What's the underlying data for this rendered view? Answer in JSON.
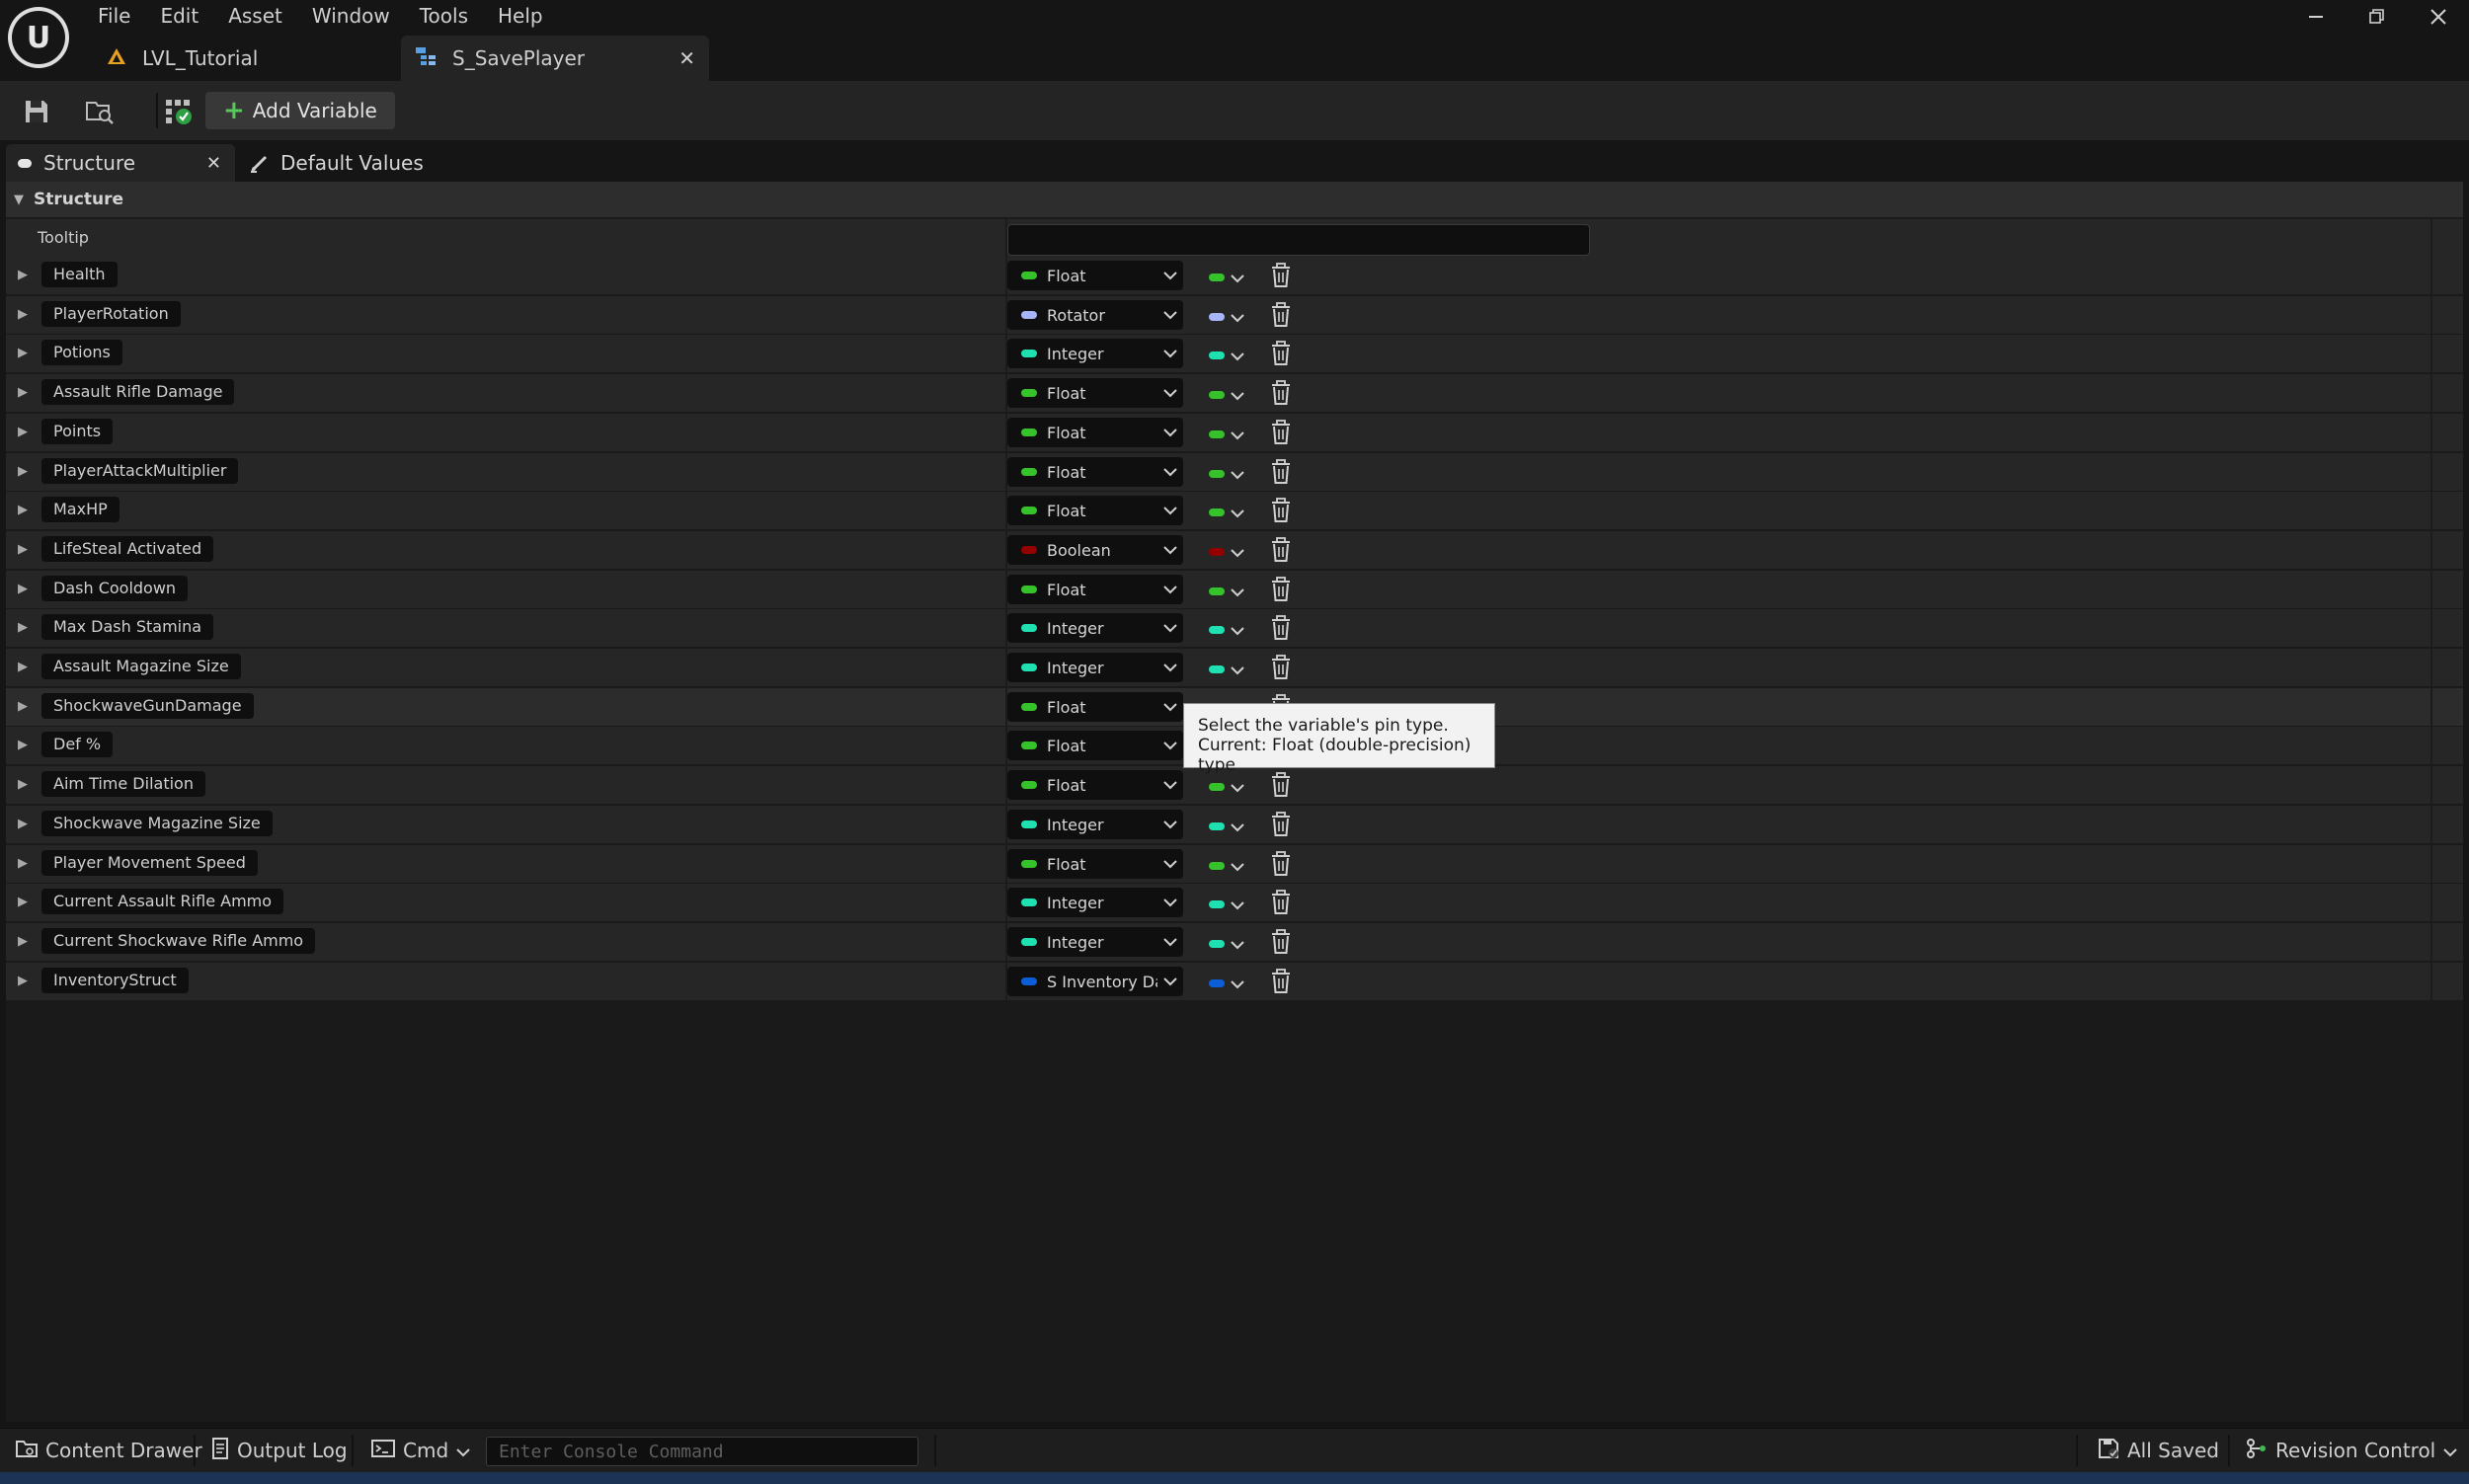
{
  "menu": {
    "items": [
      "File",
      "Edit",
      "Asset",
      "Window",
      "Tools",
      "Help"
    ]
  },
  "doc_tabs": [
    {
      "label": "LVL_Tutorial",
      "active": false
    },
    {
      "label": "S_SavePlayer",
      "active": true
    }
  ],
  "toolbar": {
    "add_variable_label": "Add Variable"
  },
  "panel_tabs": {
    "structure": "Structure",
    "default_values": "Default Values"
  },
  "section": {
    "title": "Structure",
    "tooltip_label": "Tooltip",
    "tooltip_value": ""
  },
  "pin_colors": {
    "Float": "#35c22a",
    "Rotator": "#a8b4f8",
    "Integer": "#1fe0b0",
    "Boolean": "#940000",
    "Struct": "#0b5ed6"
  },
  "variables": [
    {
      "name": "Health",
      "type": "Float",
      "pin": "Float"
    },
    {
      "name": "PlayerRotation",
      "type": "Rotator",
      "pin": "Rotator"
    },
    {
      "name": "Potions",
      "type": "Integer",
      "pin": "Integer"
    },
    {
      "name": "Assault Rifle Damage",
      "type": "Float",
      "pin": "Float"
    },
    {
      "name": "Points",
      "type": "Float",
      "pin": "Float"
    },
    {
      "name": "PlayerAttackMultiplier",
      "type": "Float",
      "pin": "Float"
    },
    {
      "name": "MaxHP",
      "type": "Float",
      "pin": "Float"
    },
    {
      "name": "LifeSteal Activated",
      "type": "Boolean",
      "pin": "Boolean"
    },
    {
      "name": "Dash Cooldown",
      "type": "Float",
      "pin": "Float"
    },
    {
      "name": "Max Dash Stamina",
      "type": "Integer",
      "pin": "Integer"
    },
    {
      "name": "Assault Magazine Size",
      "type": "Integer",
      "pin": "Integer"
    },
    {
      "name": "ShockwaveGunDamage",
      "type": "Float",
      "pin": "Float"
    },
    {
      "name": "Def %",
      "type": "Float",
      "pin": "Float"
    },
    {
      "name": "Aim Time Dilation",
      "type": "Float",
      "pin": "Float"
    },
    {
      "name": "Shockwave Magazine Size",
      "type": "Integer",
      "pin": "Integer"
    },
    {
      "name": "Player Movement Speed",
      "type": "Float",
      "pin": "Float"
    },
    {
      "name": "Current Assault Rifle Ammo",
      "type": "Integer",
      "pin": "Integer"
    },
    {
      "name": "Current Shockwave Rifle Ammo",
      "type": "Integer",
      "pin": "Integer"
    },
    {
      "name": "InventoryStruct",
      "type": "S Inventory Da",
      "pin": "Struct"
    }
  ],
  "tooltip": {
    "line1": "Select the variable's pin type.",
    "line2": "Current: Float (double-precision) type"
  },
  "statusbar": {
    "content_drawer": "Content Drawer",
    "output_log": "Output Log",
    "cmd": "Cmd",
    "console_placeholder": "Enter Console Command",
    "all_saved": "All Saved",
    "revision_control": "Revision Control"
  }
}
